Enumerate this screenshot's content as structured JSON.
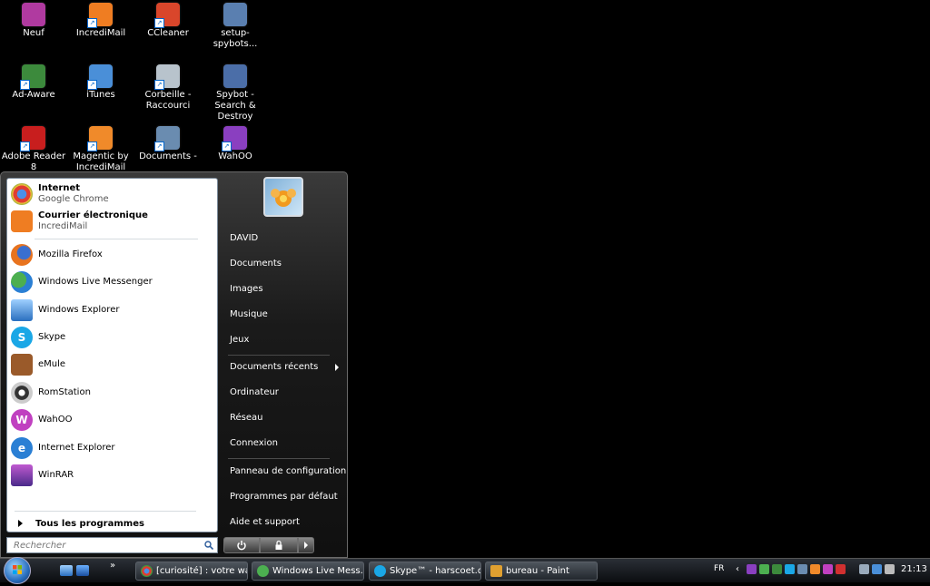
{
  "desktop": {
    "icons": [
      {
        "label": "Neuf",
        "color": "#b03aa0"
      },
      {
        "label": "IncrediMail",
        "color": "#ef7d22"
      },
      {
        "label": "CCleaner",
        "color": "#d9462b"
      },
      {
        "label": "setup-spybots...",
        "color": "#5a7fb0"
      },
      {
        "label": "Ad-Aware",
        "color": "#3c8a3c"
      },
      {
        "label": "iTunes",
        "color": "#4a8fd8"
      },
      {
        "label": "Corbeille - Raccourci",
        "color": "#b8c3cc"
      },
      {
        "label": "Spybot - Search & Destroy",
        "color": "#4b6ea8"
      },
      {
        "label": "Adobe Reader 8",
        "color": "#c81e1e"
      },
      {
        "label": "Magentic by IncrediMail",
        "color": "#f08a2a"
      },
      {
        "label": "Documents -",
        "color": "#6a8cb0"
      },
      {
        "label": "WahOO",
        "color": "#8a3fc0"
      }
    ]
  },
  "start_menu": {
    "pinned": [
      {
        "title": "Internet",
        "subtitle": "Google Chrome",
        "color": "#3c9a3c"
      },
      {
        "title": "Courrier électronique",
        "subtitle": "IncrediMail",
        "color": "#ef7d22"
      }
    ],
    "recent": [
      {
        "label": "Mozilla Firefox",
        "color": "#e8731e"
      },
      {
        "label": "Windows Live Messenger",
        "color": "#4caf50"
      },
      {
        "label": "Windows Explorer",
        "color": "#3a78c8"
      },
      {
        "label": "Skype",
        "color": "#1aa7e6"
      },
      {
        "label": "eMule",
        "color": "#9a5a2a"
      },
      {
        "label": "RomStation",
        "color": "#333333"
      },
      {
        "label": "WahOO",
        "color": "#c040c0"
      },
      {
        "label": "Internet Explorer",
        "color": "#2a7fd4"
      },
      {
        "label": "WinRAR",
        "color": "#7a3a9a"
      }
    ],
    "all_programs": "Tous les programmes",
    "search_placeholder": "Rechercher",
    "right_items": [
      "DAVID",
      "Documents",
      "Images",
      "Musique",
      "Jeux",
      "Documents récents",
      "Ordinateur",
      "Réseau",
      "Connexion",
      "Panneau de configuration",
      "Programmes par défaut",
      "Aide et support"
    ]
  },
  "taskbar": {
    "buttons": [
      {
        "label": "[curiosité] : votre wa...",
        "color": "#3c9a3c"
      },
      {
        "label": "Windows Live Mess...",
        "color": "#4caf50"
      },
      {
        "label": "Skype™ - harscoet.q...",
        "color": "#1aa7e6"
      },
      {
        "label": "bureau - Paint",
        "color": "#e0a030"
      }
    ],
    "language": "FR",
    "clock": "21:13"
  }
}
